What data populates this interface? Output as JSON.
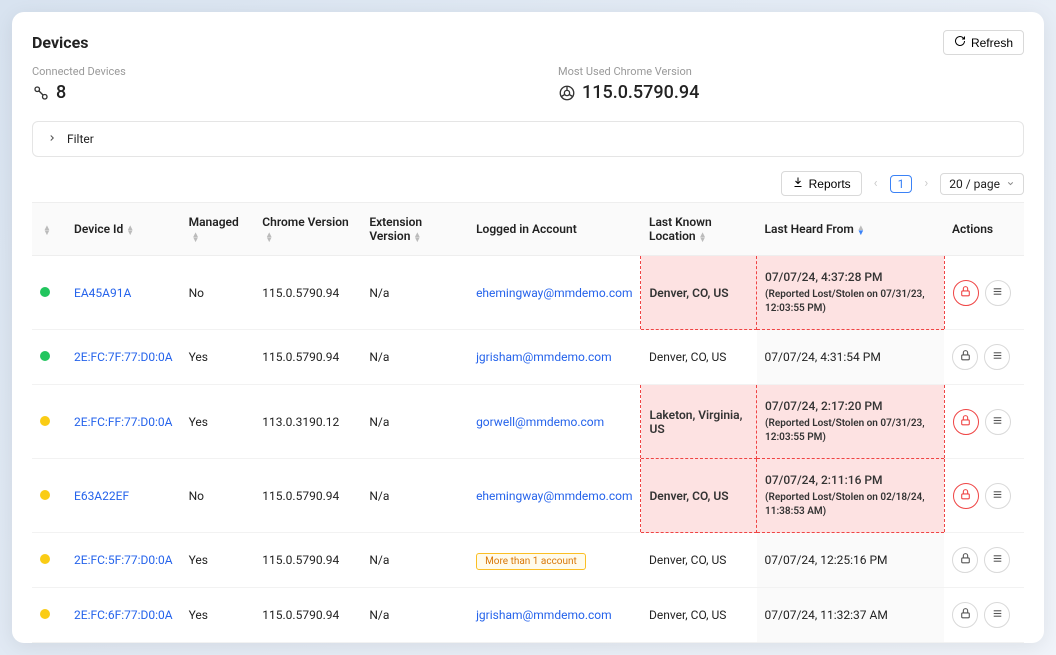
{
  "header": {
    "title": "Devices",
    "refresh_label": "Refresh"
  },
  "stats": {
    "connected_label": "Connected Devices",
    "connected_value": "8",
    "chrome_label": "Most Used Chrome Version",
    "chrome_value": "115.0.5790.94"
  },
  "filter": {
    "label": "Filter"
  },
  "controls": {
    "reports_label": "Reports",
    "page_current": "1",
    "page_size_label": "20 / page"
  },
  "columns": {
    "device_id": "Device Id",
    "managed": "Managed",
    "chrome_version": "Chrome Version",
    "extension_version": "Extension Version",
    "logged_in": "Logged in Account",
    "last_location": "Last Known Location",
    "last_heard": "Last Heard From",
    "actions": "Actions"
  },
  "badges": {
    "multi_account": "More than 1 account"
  },
  "rows": [
    {
      "status": "green",
      "device_id": "EA45A91A",
      "managed": "No",
      "chrome_version": "115.0.5790.94",
      "extension_version": "N/a",
      "account": "ehemingway@mmdemo.com",
      "account_type": "link",
      "location": "Denver, CO, US",
      "last_heard": "07/07/24, 4:37:28 PM",
      "reported_note": "(Reported Lost/Stolen on 07/31/23, 12:03:55 PM)",
      "alert": true,
      "lock_danger": true
    },
    {
      "status": "green",
      "device_id": "2E:FC:7F:77:D0:0A",
      "managed": "Yes",
      "chrome_version": "115.0.5790.94",
      "extension_version": "N/a",
      "account": "jgrisham@mmdemo.com",
      "account_type": "link",
      "location": "Denver, CO, US",
      "last_heard": "07/07/24, 4:31:54 PM",
      "reported_note": "",
      "alert": false,
      "lock_danger": false
    },
    {
      "status": "yellow",
      "device_id": "2E:FC:FF:77:D0:0A",
      "managed": "Yes",
      "chrome_version": "113.0.3190.12",
      "extension_version": "N/a",
      "account": "gorwell@mmdemo.com",
      "account_type": "link",
      "location": "Laketon, Virginia, US",
      "last_heard": "07/07/24, 2:17:20 PM",
      "reported_note": "(Reported Lost/Stolen on 07/31/23, 12:03:55 PM)",
      "alert": true,
      "lock_danger": true
    },
    {
      "status": "yellow",
      "device_id": "E63A22EF",
      "managed": "No",
      "chrome_version": "115.0.5790.94",
      "extension_version": "N/a",
      "account": "ehemingway@mmdemo.com",
      "account_type": "link",
      "location": "Denver, CO, US",
      "last_heard": "07/07/24, 2:11:16 PM",
      "reported_note": "(Reported Lost/Stolen on 02/18/24, 11:38:53 AM)",
      "alert": true,
      "lock_danger": true
    },
    {
      "status": "yellow",
      "device_id": "2E:FC:5F:77:D0:0A",
      "managed": "Yes",
      "chrome_version": "115.0.5790.94",
      "extension_version": "N/a",
      "account": "More than 1 account",
      "account_type": "badge",
      "location": "Denver, CO, US",
      "last_heard": "07/07/24, 12:25:16 PM",
      "reported_note": "",
      "alert": false,
      "lock_danger": false
    },
    {
      "status": "yellow",
      "device_id": "2E:FC:6F:77:D0:0A",
      "managed": "Yes",
      "chrome_version": "115.0.5790.94",
      "extension_version": "N/a",
      "account": "jgrisham@mmdemo.com",
      "account_type": "link",
      "location": "Denver, CO, US",
      "last_heard": "07/07/24, 11:32:37 AM",
      "reported_note": "",
      "alert": false,
      "lock_danger": false
    }
  ]
}
